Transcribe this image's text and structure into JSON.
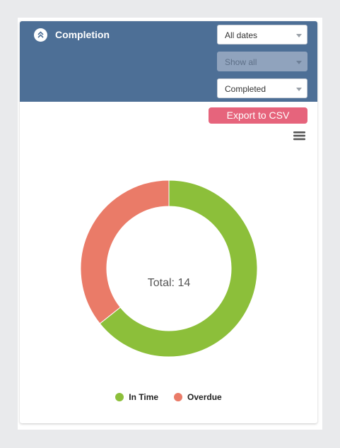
{
  "widget": {
    "title": "Completion",
    "collapse_icon": "chevrons-up-icon",
    "filters": [
      {
        "value": "All dates",
        "disabled": false
      },
      {
        "value": "Show all",
        "disabled": true
      },
      {
        "value": "Completed",
        "disabled": false
      }
    ],
    "export_label": "Export to CSV",
    "menu_icon": "hamburger-menu-icon"
  },
  "chart_data": {
    "type": "pie",
    "total_label": "Total: 14",
    "series": [
      {
        "name": "In Time",
        "value": 9,
        "color": "#8cbf3a"
      },
      {
        "name": "Overdue",
        "value": 5,
        "color": "#ea7b68"
      }
    ]
  },
  "colors": {
    "header": "#4d6f96",
    "export_button": "#e6647c"
  }
}
